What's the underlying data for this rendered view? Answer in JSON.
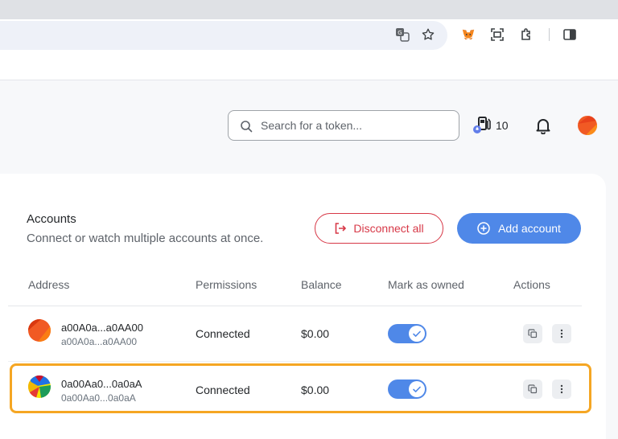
{
  "browser": {
    "icons": [
      "translate-icon",
      "star-icon",
      "metamask-fox-icon",
      "screenshot-icon",
      "extensions-icon",
      "side-panel-icon"
    ]
  },
  "header": {
    "search_placeholder": "Search for a token...",
    "gas_count": "10"
  },
  "accounts": {
    "title": "Accounts",
    "subtitle": "Connect or watch multiple accounts at once.",
    "disconnect_label": "Disconnect all",
    "add_label": "Add account"
  },
  "table": {
    "headers": {
      "address": "Address",
      "permissions": "Permissions",
      "balance": "Balance",
      "owned": "Mark as owned",
      "actions": "Actions"
    },
    "rows": [
      {
        "name": "a00A0a...a0AA00",
        "address": "a00A0a...a0AA00",
        "permission": "Connected",
        "balance": "$0.00",
        "owned": true
      },
      {
        "name": "0a00Aa0...0a0aA",
        "address": "0a00Aa0...0a0aA",
        "permission": "Connected",
        "balance": "$0.00",
        "owned": true
      }
    ]
  },
  "colors": {
    "accent": "#4f88e8",
    "danger": "#d73847",
    "highlight": "#f5a623"
  }
}
